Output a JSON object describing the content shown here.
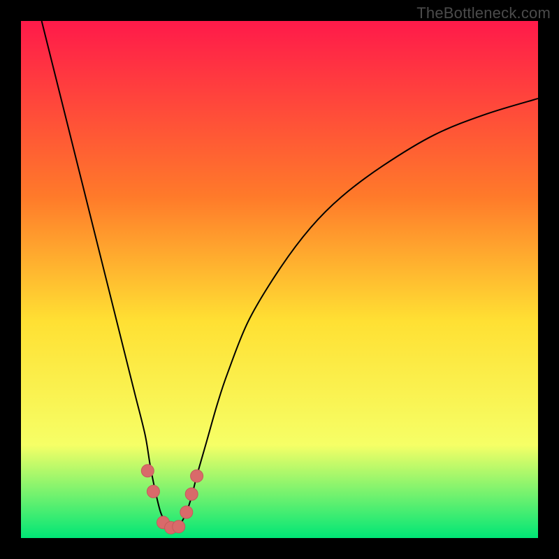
{
  "watermark": "TheBottleneck.com",
  "colors": {
    "gradient_top": "#ff1a4a",
    "gradient_upper_mid": "#ff7a2a",
    "gradient_mid": "#ffe033",
    "gradient_lower_mid": "#f6ff66",
    "gradient_bottom": "#00e676",
    "curve": "#000000",
    "marker": "#d96a6a",
    "marker_stroke": "#c45a5a"
  },
  "chart_data": {
    "type": "line",
    "title": "",
    "xlabel": "",
    "ylabel": "",
    "xlim": [
      0,
      100
    ],
    "ylim": [
      0,
      100
    ],
    "series": [
      {
        "name": "bottleneck-curve",
        "x": [
          4,
          6,
          8,
          10,
          12,
          14,
          16,
          18,
          20,
          22,
          24,
          25,
          26,
          27,
          28,
          29,
          30,
          31,
          32,
          33,
          34,
          36,
          38,
          40,
          44,
          50,
          56,
          62,
          70,
          80,
          90,
          100
        ],
        "y": [
          100,
          92,
          84,
          76,
          68,
          60,
          52,
          44,
          36,
          28,
          20,
          14,
          9,
          5,
          3,
          2,
          2,
          3,
          5,
          8,
          12,
          19,
          26,
          32,
          42,
          52,
          60,
          66,
          72,
          78,
          82,
          85
        ]
      }
    ],
    "markers": {
      "name": "salmon-dots",
      "x": [
        24.5,
        25.6,
        27.5,
        29.0,
        30.5,
        32.0,
        33.0,
        34.0
      ],
      "y": [
        13.0,
        9.0,
        3.0,
        2.0,
        2.2,
        5.0,
        8.5,
        12.0
      ]
    }
  }
}
